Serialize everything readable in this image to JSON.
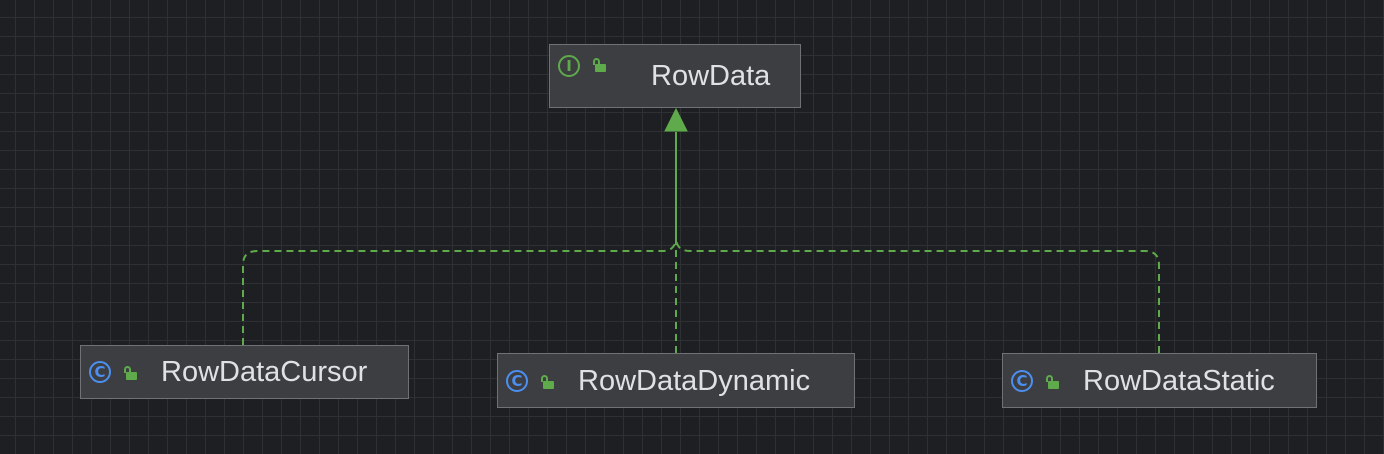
{
  "diagram": {
    "type": "uml-class-hierarchy",
    "colors": {
      "background": "#1e1f22",
      "node_fill": "#3c3e42",
      "node_border": "#6f7176",
      "edge": "#5faa4a",
      "class_icon": "#4d8ff0",
      "interface_icon": "#5faa4a",
      "text": "#dfe1e5"
    },
    "nodes": [
      {
        "id": "rowdata",
        "label": "RowData",
        "kind": "interface",
        "icon": "interface-icon",
        "icon_glyph": "I",
        "visibility": "public",
        "visibility_icon": "unlock-icon"
      },
      {
        "id": "cursor",
        "label": "RowDataCursor",
        "kind": "class",
        "icon": "class-icon",
        "icon_glyph": "C",
        "visibility": "public",
        "visibility_icon": "unlock-icon"
      },
      {
        "id": "dynamic",
        "label": "RowDataDynamic",
        "kind": "class",
        "icon": "class-icon",
        "icon_glyph": "C",
        "visibility": "public",
        "visibility_icon": "unlock-icon"
      },
      {
        "id": "static",
        "label": "RowDataStatic",
        "kind": "class",
        "icon": "class-icon",
        "icon_glyph": "C",
        "visibility": "public",
        "visibility_icon": "unlock-icon"
      }
    ],
    "edges": [
      {
        "from": "cursor",
        "to": "rowdata",
        "relation": "implements",
        "style": "dashed"
      },
      {
        "from": "dynamic",
        "to": "rowdata",
        "relation": "implements",
        "style": "dashed"
      },
      {
        "from": "static",
        "to": "rowdata",
        "relation": "implements",
        "style": "dashed"
      }
    ]
  }
}
